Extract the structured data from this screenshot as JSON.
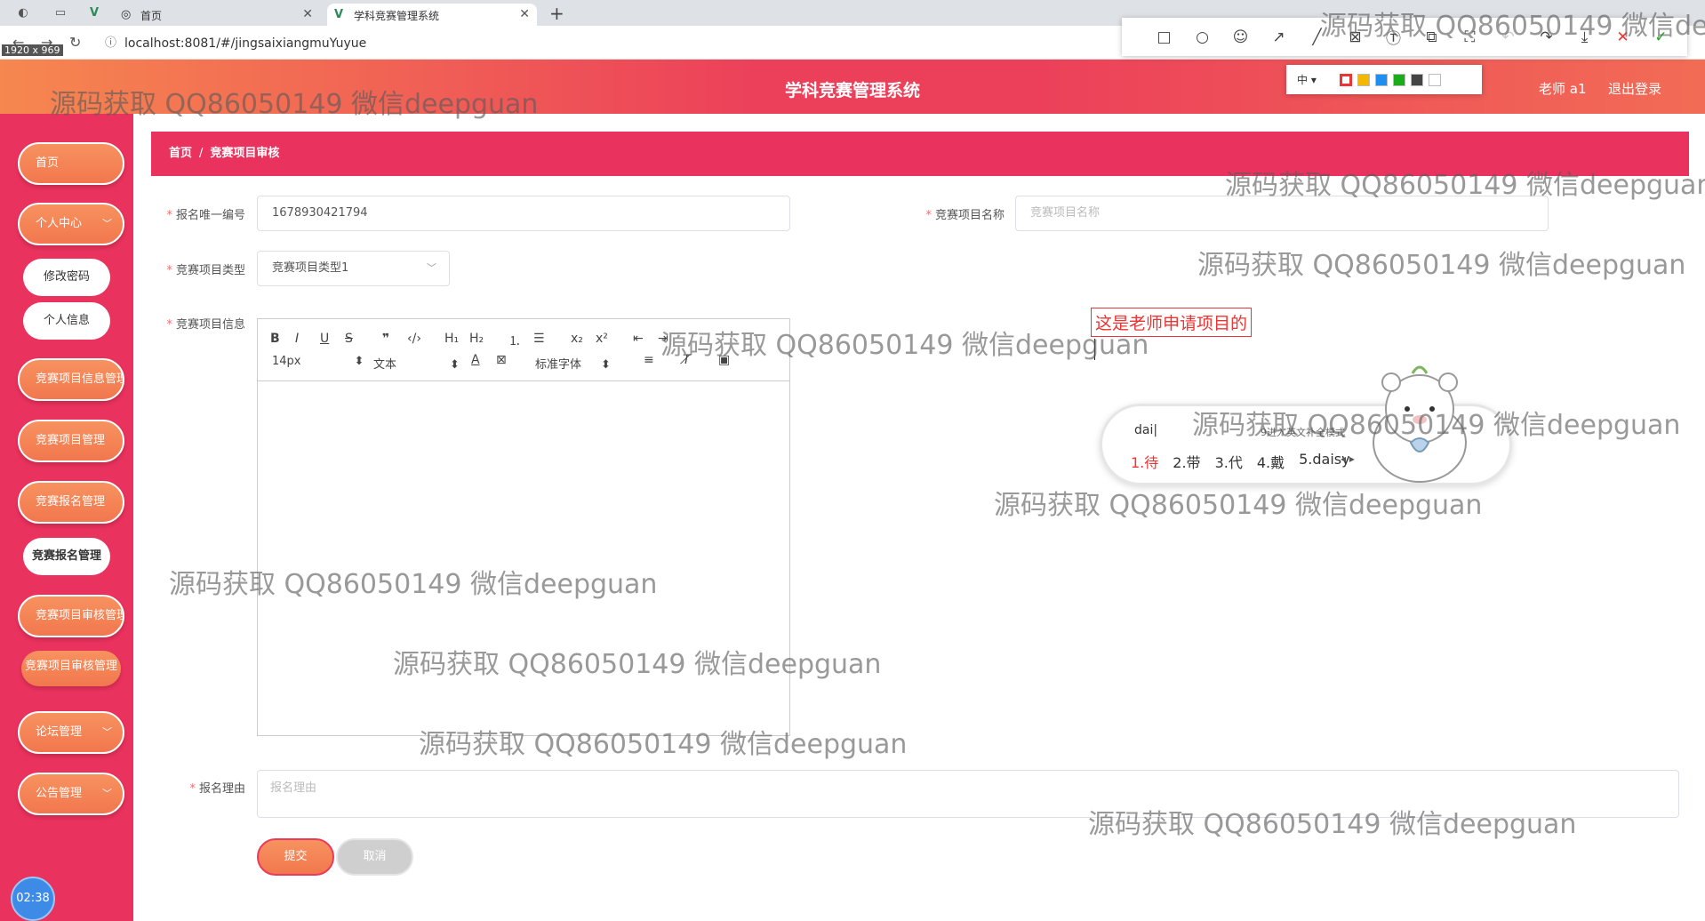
{
  "browser": {
    "tabs": [
      {
        "label": "首页",
        "active": false
      },
      {
        "label": "学科竞赛管理系统",
        "active": true
      }
    ],
    "url": "localhost:8081/#/jingsaixiangmuYuyue",
    "size_label": "1920 x 969"
  },
  "header": {
    "title": "学科竞赛管理系统",
    "user": "老师 a1",
    "logout": "退出登录"
  },
  "sidebar": {
    "home": "首页",
    "personal_center": "个人中心",
    "change_password": "修改密码",
    "personal_info": "个人信息",
    "project_info_mgmt": "竞赛项目信息管理",
    "project_mgmt": "竞赛项目管理",
    "signup_mgmt": "竞赛报名管理",
    "signup_mgmt_sub": "竞赛报名管理",
    "review_mgmt": "竞赛项目审核管理",
    "review_mgmt_sub": "竞赛项目审核管理",
    "forum_mgmt": "论坛管理",
    "notice_mgmt": "公告管理",
    "clock": "02:38"
  },
  "breadcrumb": {
    "home": "首页",
    "sep": "/",
    "current": "竞赛项目审核"
  },
  "form": {
    "signup_id_label": "报名唯一编号",
    "signup_id_value": "1678930421794",
    "project_name_label": "竞赛项目名称",
    "project_name_placeholder": "竞赛项目名称",
    "project_type_label": "竞赛项目类型",
    "project_type_value": "竞赛项目类型1",
    "project_info_label": "竞赛项目信息",
    "reason_label": "报名理由",
    "reason_placeholder": "报名理由",
    "submit": "提交",
    "cancel": "取消"
  },
  "editor": {
    "font_size": "14px",
    "block_format": "文本",
    "font_family": "标准字体"
  },
  "annotation": {
    "note_text": "这是老师申请项目的",
    "size_select": "中 ▾",
    "colors": [
      "#e33333",
      "#f5b800",
      "#1e8ff0",
      "#1aad19",
      "#444444",
      "#ffffff"
    ]
  },
  "ime": {
    "pinyin": "dai|",
    "hint": "9进入英文补全模式",
    "candidates": [
      "1.待",
      "2.带",
      "3.代",
      "4.戴",
      "5.daisy"
    ]
  },
  "watermark": "源码获取 QQ86050149 微信deepguan"
}
